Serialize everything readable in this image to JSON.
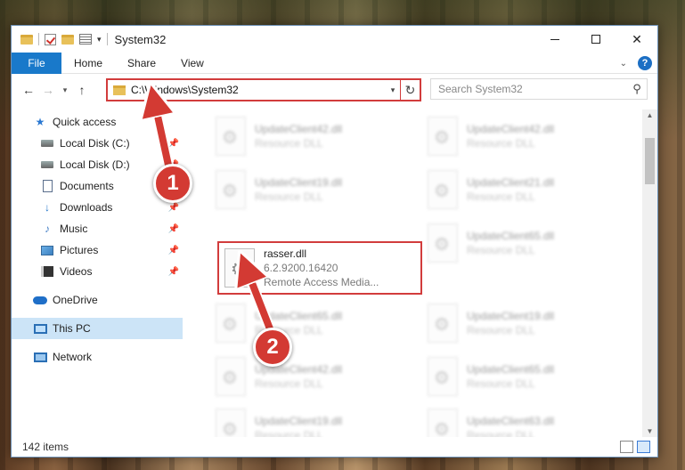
{
  "window": {
    "title": "System32"
  },
  "ribbon": {
    "tabs": [
      "File",
      "Home",
      "Share",
      "View"
    ],
    "help": "?"
  },
  "nav": {
    "back": "←",
    "forward": "→",
    "recent": "▾",
    "up": "↑",
    "address": "C:\\Windows\\System32",
    "refresh": "↻",
    "search_placeholder": "Search System32",
    "search_icon": "⚲"
  },
  "sidebar": {
    "items": [
      {
        "label": "Quick access"
      },
      {
        "label": "Local Disk (C:)"
      },
      {
        "label": "Local Disk (D:)"
      },
      {
        "label": "Documents"
      },
      {
        "label": "Downloads"
      },
      {
        "label": "Music"
      },
      {
        "label": "Pictures"
      },
      {
        "label": "Videos"
      },
      {
        "label": "OneDrive"
      },
      {
        "label": "This PC"
      },
      {
        "label": "Network"
      }
    ]
  },
  "files": [
    {
      "name": "UpdateClient42.dll",
      "meta": "Resource DLL"
    },
    {
      "name": "UpdateClient42.dll",
      "meta": "Resource DLL"
    },
    {
      "name": "UpdateClient19.dll",
      "meta": "Resource DLL"
    },
    {
      "name": "UpdateClient21.dll",
      "meta": "Resource DLL"
    },
    {
      "name": "rasser.dll",
      "version": "6.2.9200.16420",
      "meta": "Remote Access Media..."
    },
    {
      "name": "UpdateClient65.dll",
      "meta": "Resource DLL"
    },
    {
      "name": "UpdateClient65.dll",
      "meta": "Resource DLL"
    },
    {
      "name": "UpdateClient19.dll",
      "meta": "Resource DLL"
    },
    {
      "name": "UpdateClient42.dll",
      "meta": "Resource DLL"
    },
    {
      "name": "UpdateClient65.dll",
      "meta": "Resource DLL"
    },
    {
      "name": "UpdateClient19.dll",
      "meta": "Resource DLL"
    },
    {
      "name": "UpdateClient63.dll",
      "meta": "Resource DLL"
    }
  ],
  "status": {
    "count": "142 items"
  },
  "callouts": {
    "one": "1",
    "two": "2"
  },
  "colors": {
    "accent": "#1979ca",
    "highlight": "#d23c3c",
    "selected": "#cce4f7"
  }
}
